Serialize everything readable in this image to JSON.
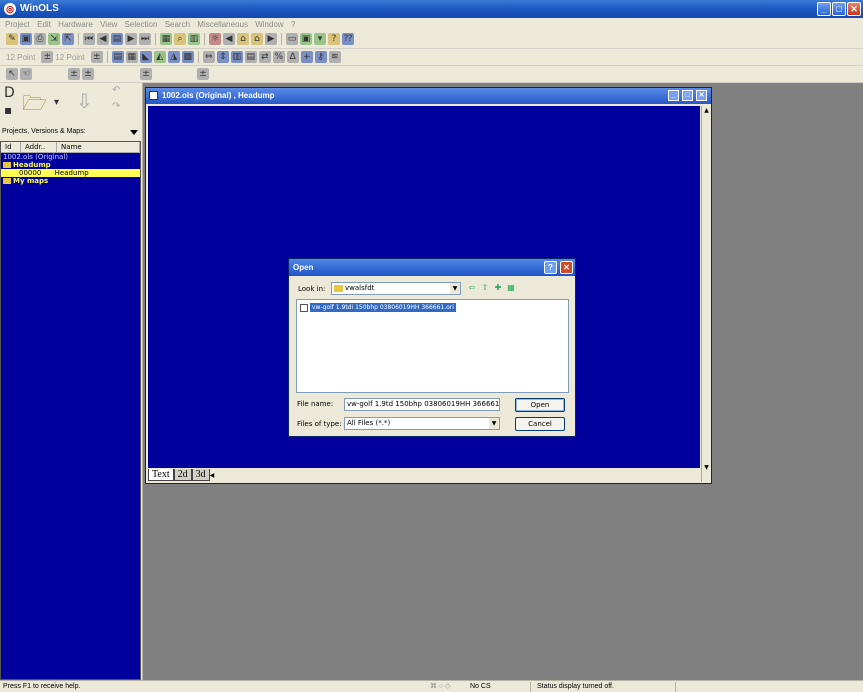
{
  "app": {
    "title": "WinOLS"
  },
  "window_controls": {
    "minimize": "_",
    "maximize": "□",
    "close": "✕"
  },
  "menu": [
    "Project",
    "Edit",
    "Hardware",
    "View",
    "Selection",
    "Search",
    "Miscellaneous",
    "Window",
    "?"
  ],
  "toolbar2": {
    "font_a": "12 Point",
    "font_b": "12 Point"
  },
  "left_panel": {
    "label": "Projects, Versions & Maps:",
    "columns": [
      "Id",
      "Addr..",
      "Name"
    ],
    "rows": [
      {
        "text": "1002.ols (Original)",
        "type": "project"
      },
      {
        "text": "Headump",
        "type": "folder"
      },
      {
        "addr": "00000",
        "name": "Headump",
        "type": "selected"
      },
      {
        "text": "My maps",
        "type": "folder"
      }
    ]
  },
  "doc_window": {
    "title": "1002.ols (Original) , Headump",
    "tabs": [
      "Text",
      "2d",
      "3d"
    ]
  },
  "open_dialog": {
    "title": "Open",
    "help_label": "?",
    "close_label": "✕",
    "look_in_label": "Look in:",
    "look_in_value": "vwalsfdt",
    "file_item": "vw-golf 1.9tdi 150bhp 03806019HH 366661.ori",
    "file_name_label": "File name:",
    "file_name_value": "vw-golf 1.9td 150bhp 03806019HH 366661.o",
    "file_type_label": "Files of type:",
    "file_type_value": "All Files (*.*)",
    "open_button": "Open",
    "cancel_button": "Cancel"
  },
  "status": {
    "help": "Press F1 to receive help.",
    "mid": "No CS",
    "message": "Status display turned off."
  }
}
